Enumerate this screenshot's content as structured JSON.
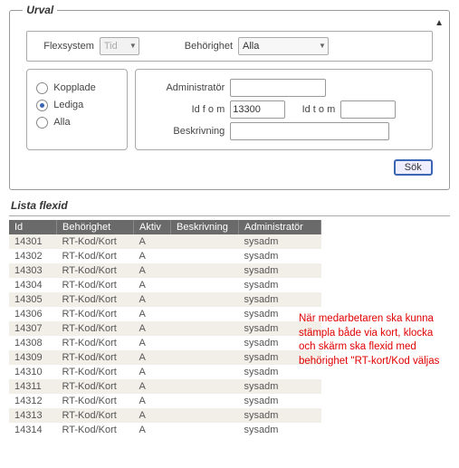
{
  "urval": {
    "legend": "Urval",
    "flexsystem_label": "Flexsystem",
    "flexsystem_value": "Tid",
    "behorighet_label": "Behörighet",
    "behorighet_value": "Alla",
    "radios": {
      "kopplade": "Kopplade",
      "lediga": "Lediga",
      "alla": "Alla",
      "selected": "lediga"
    },
    "fields": {
      "administrator_label": "Administratör",
      "administrator_value": "",
      "id_from_label": "Id f o m",
      "id_from_value": "13300",
      "id_to_label": "Id t o m",
      "id_to_value": "",
      "beskrivning_label": "Beskrivning",
      "beskrivning_value": ""
    },
    "search_button": "Sök"
  },
  "list": {
    "title": "Lista flexid",
    "columns": {
      "id": "Id",
      "behorighet": "Behörighet",
      "aktiv": "Aktiv",
      "beskrivning": "Beskrivning",
      "administrator": "Administratör"
    },
    "rows": [
      {
        "id": "14301",
        "behorighet": "RT-Kod/Kort",
        "aktiv": "A",
        "beskrivning": "",
        "administrator": "sysadm"
      },
      {
        "id": "14302",
        "behorighet": "RT-Kod/Kort",
        "aktiv": "A",
        "beskrivning": "",
        "administrator": "sysadm"
      },
      {
        "id": "14303",
        "behorighet": "RT-Kod/Kort",
        "aktiv": "A",
        "beskrivning": "",
        "administrator": "sysadm"
      },
      {
        "id": "14304",
        "behorighet": "RT-Kod/Kort",
        "aktiv": "A",
        "beskrivning": "",
        "administrator": "sysadm"
      },
      {
        "id": "14305",
        "behorighet": "RT-Kod/Kort",
        "aktiv": "A",
        "beskrivning": "",
        "administrator": "sysadm"
      },
      {
        "id": "14306",
        "behorighet": "RT-Kod/Kort",
        "aktiv": "A",
        "beskrivning": "",
        "administrator": "sysadm"
      },
      {
        "id": "14307",
        "behorighet": "RT-Kod/Kort",
        "aktiv": "A",
        "beskrivning": "",
        "administrator": "sysadm"
      },
      {
        "id": "14308",
        "behorighet": "RT-Kod/Kort",
        "aktiv": "A",
        "beskrivning": "",
        "administrator": "sysadm"
      },
      {
        "id": "14309",
        "behorighet": "RT-Kod/Kort",
        "aktiv": "A",
        "beskrivning": "",
        "administrator": "sysadm"
      },
      {
        "id": "14310",
        "behorighet": "RT-Kod/Kort",
        "aktiv": "A",
        "beskrivning": "",
        "administrator": "sysadm"
      },
      {
        "id": "14311",
        "behorighet": "RT-Kod/Kort",
        "aktiv": "A",
        "beskrivning": "",
        "administrator": "sysadm"
      },
      {
        "id": "14312",
        "behorighet": "RT-Kod/Kort",
        "aktiv": "A",
        "beskrivning": "",
        "administrator": "sysadm"
      },
      {
        "id": "14313",
        "behorighet": "RT-Kod/Kort",
        "aktiv": "A",
        "beskrivning": "",
        "administrator": "sysadm"
      },
      {
        "id": "14314",
        "behorighet": "RT-Kod/Kort",
        "aktiv": "A",
        "beskrivning": "",
        "administrator": "sysadm"
      }
    ]
  },
  "annotation": "När medarbetaren ska kunna stämpla både via kort, klocka och skärm ska flexid med behörighet \"RT-kort/Kod väljas"
}
